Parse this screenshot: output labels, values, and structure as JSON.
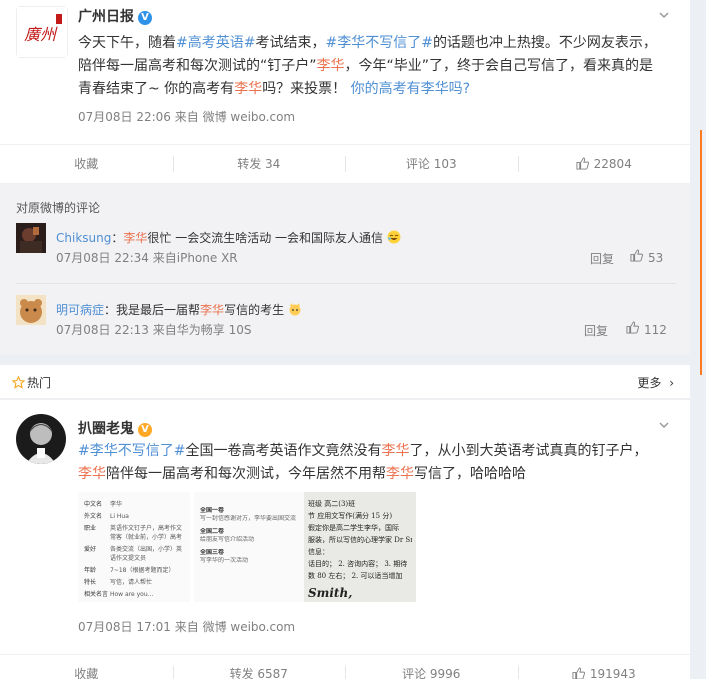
{
  "post1": {
    "author": "广州日报",
    "text_parts": [
      {
        "t": "今天下午，随着",
        "c": ""
      },
      {
        "t": "#高考英语#",
        "c": "topic"
      },
      {
        "t": "考试结束，",
        "c": ""
      },
      {
        "t": "#李华不写信了#",
        "c": "topic"
      },
      {
        "t": "的话题也冲上热搜。不少网友表示，陪伴每一届高考和每次测试的“钉子户”",
        "c": ""
      },
      {
        "t": "李华",
        "c": "kw"
      },
      {
        "t": "，今年“毕业”了，终于会自己写信了，看来真的是青春结束了~ 你的高考有",
        "c": ""
      },
      {
        "t": "李华",
        "c": "kw"
      },
      {
        "t": "吗？来投票！ ",
        "c": ""
      },
      {
        "t": "你的高考有李华吗?",
        "c": "topic"
      }
    ],
    "meta": "07月08日 22:06  来自 微博 weibo.com",
    "actions": {
      "collect": "收藏",
      "repost": "转发 34",
      "comment": "评论 103",
      "like": "22804"
    }
  },
  "comments": {
    "title": "对原微博的评论",
    "items": [
      {
        "user": "Chiksung",
        "sep": "：",
        "pre": "",
        "kw": "李华",
        "post": "很忙 一会交流生啥活动 一会和国际友人通信",
        "time": "07月08日 22:34 来自iPhone XR",
        "reply": "回复",
        "likes": "53"
      },
      {
        "user": "明可病症",
        "sep": "：",
        "pre": "我是最后一届帮",
        "kw": "李华",
        "post": "写信的考生",
        "time": "07月08日 22:13 来自华为畅享 10S",
        "reply": "回复",
        "likes": "112"
      }
    ]
  },
  "hot": {
    "label": "热门",
    "more": "更多"
  },
  "post2": {
    "author": "扒圈老鬼",
    "text_parts": [
      {
        "t": "#李华不写信了#",
        "c": "topic"
      },
      {
        "t": "全国一卷高考英语作文竟然没有",
        "c": ""
      },
      {
        "t": "李华",
        "c": "kw"
      },
      {
        "t": "了，从小到大英语考试真真的钉子户，",
        "c": ""
      },
      {
        "t": "李华",
        "c": "kw"
      },
      {
        "t": "陪伴每一届高考和每次测试，今年居然不用帮",
        "c": ""
      },
      {
        "t": "李华",
        "c": "kw"
      },
      {
        "t": "写信了，哈哈哈哈",
        "c": ""
      }
    ],
    "pic1_rows": [
      [
        "中文名",
        "李华"
      ],
      [
        "外文名",
        "Li Hua"
      ],
      [
        "职业",
        "英语作文钉子户，高考作文常客（就业前，小学）高考英语作文组织人"
      ],
      [
        "爱好",
        "各类交流（出国，小学）英语作文提文员"
      ],
      [
        "年龄",
        "7~18（根据考题而定）"
      ],
      [
        "特长",
        "写信，请人帮忙"
      ],
      [
        "相关名言",
        "How are you…"
      ]
    ],
    "pic2_lines": [
      "全国一卷",
      "写一封信感谢对方，李华要出国交流",
      "全国二卷",
      "给朋友写信介绍活动",
      "全国三卷",
      "写李华的一次活动"
    ],
    "pic3_lines": [
      "班级  高二(3)班",
      "节  应用文写作(满分 15 分)",
      "假定你是高二学生李华，国际",
      "服装，所以写信的心理学家 Dr Sm",
      "信息：",
      "话目的；  2. 咨询内容；  3. 期待",
      "数 80 左右；  2. 可以适当增加",
      "Smith,"
    ],
    "meta": "07月08日 17:01  来自 微博 weibo.com",
    "actions": {
      "collect": "收藏",
      "repost": "转发 6587",
      "comment": "评论 9996",
      "like": "191943"
    }
  },
  "colors": {
    "accent": "#eb7350",
    "topic": "#4f8fd4",
    "bg": "#eceff3"
  }
}
